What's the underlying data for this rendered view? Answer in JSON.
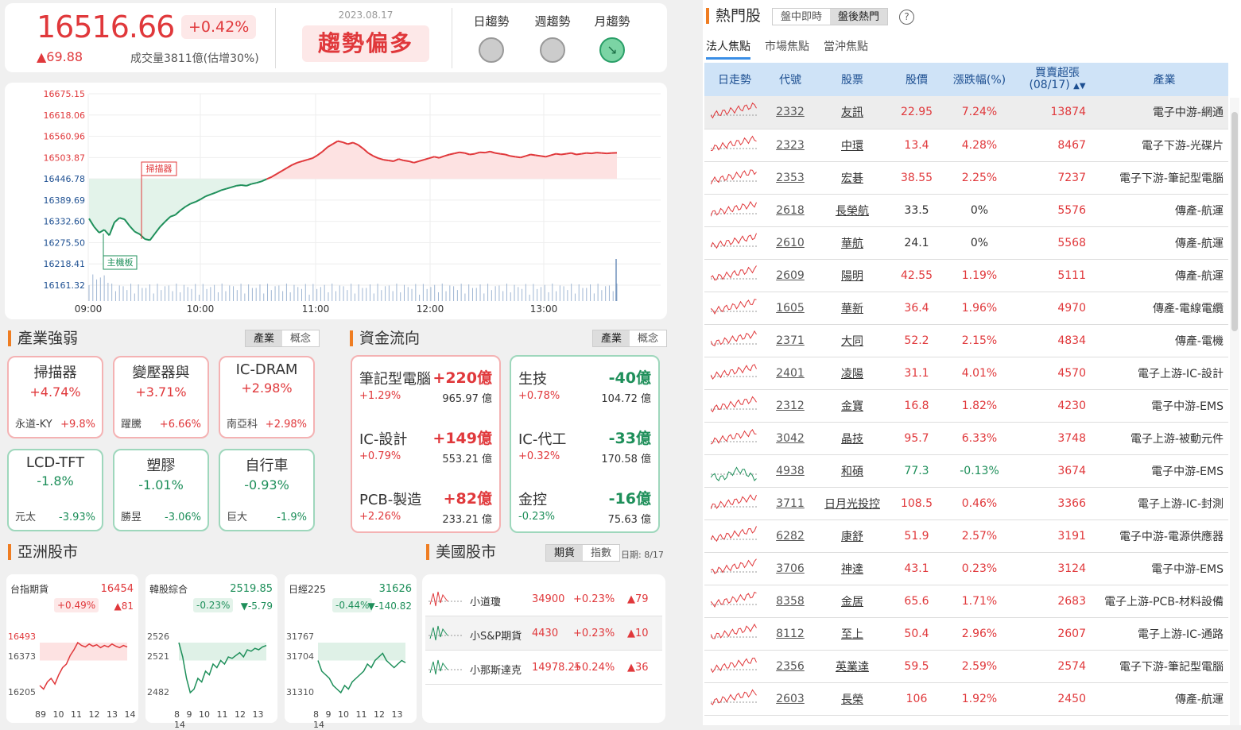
{
  "header": {
    "index_value": "16516.66",
    "index_pct": "+0.42%",
    "index_change": "▲69.88",
    "volume": "成交量3811億(估增30%)",
    "date": "2023.08.17",
    "trend": "趨勢偏多",
    "trends": [
      {
        "label": "日趨勢",
        "state": "neutral"
      },
      {
        "label": "週趨勢",
        "state": "neutral"
      },
      {
        "label": "月趨勢",
        "state": "down"
      }
    ]
  },
  "chart_data": {
    "type": "line",
    "title": "",
    "y_ticks": [
      "16675.15",
      "16618.06",
      "16560.96",
      "16503.87",
      "16446.78",
      "16389.69",
      "16332.60",
      "16275.50",
      "16218.41",
      "16161.32"
    ],
    "ylim": [
      16161.32,
      16675.15
    ],
    "reference": 16446.78,
    "x_ticks": [
      "09:00",
      "10:00",
      "11:00",
      "12:00",
      "13:00"
    ],
    "annotations": [
      {
        "label": "掃描器"
      },
      {
        "label": "主機板"
      }
    ],
    "series": [
      {
        "values": [
          16340,
          16318,
          16302,
          16310,
          16295,
          16330,
          16342,
          16338,
          16320,
          16305,
          16298,
          16285,
          16282,
          16300,
          16318,
          16332,
          16345,
          16350,
          16362,
          16372,
          16380,
          16385,
          16392,
          16400,
          16405,
          16410,
          16416,
          16420,
          16424,
          16428,
          16430,
          16428,
          16433,
          16436,
          16440,
          16446,
          16452,
          16460,
          16468,
          16476,
          16484,
          16490,
          16494,
          16498,
          16502,
          16510,
          16520,
          16532,
          16540,
          16548,
          16545,
          16540,
          16544,
          16538,
          16528,
          16516,
          16508,
          16502,
          16498,
          16496,
          16494,
          16500,
          16496,
          16494,
          16490,
          16494,
          16498,
          16502,
          16506,
          16503,
          16508,
          16512,
          16515,
          16518,
          16516,
          16512,
          16514,
          16518,
          16517,
          16520,
          16516,
          16514,
          16512,
          16508,
          16506,
          16504,
          16508,
          16512,
          16510,
          16508,
          16506,
          16510,
          16514,
          16512,
          16514,
          16516,
          16512,
          16514,
          16516,
          16515,
          16517,
          16516,
          16515,
          16516,
          16516.66
        ]
      }
    ]
  },
  "industry": {
    "title": "產業強弱",
    "toggle": [
      "產業",
      "概念"
    ],
    "cards": [
      {
        "name": "掃描器",
        "pct": "+4.74%",
        "stock": "永道-KY",
        "stock_pct": "+9.8%",
        "dir": "up"
      },
      {
        "name": "變壓器與",
        "pct": "+3.71%",
        "stock": "躍騰",
        "stock_pct": "+6.66%",
        "dir": "up"
      },
      {
        "name": "IC-DRAM",
        "pct": "+2.98%",
        "stock": "南亞科",
        "stock_pct": "+2.98%",
        "dir": "up"
      },
      {
        "name": "LCD-TFT",
        "pct": "-1.8%",
        "stock": "元太",
        "stock_pct": "-3.93%",
        "dir": "dn"
      },
      {
        "name": "塑膠",
        "pct": "-1.01%",
        "stock": "勝昱",
        "stock_pct": "-3.06%",
        "dir": "dn"
      },
      {
        "name": "自行車",
        "pct": "-0.93%",
        "stock": "巨大",
        "stock_pct": "-1.9%",
        "dir": "dn"
      }
    ]
  },
  "flow": {
    "title": "資金流向",
    "toggle": [
      "產業",
      "概念"
    ],
    "inflow": [
      {
        "name": "筆記型電腦",
        "amount": "+220億",
        "pct": "+1.29%",
        "value": "965.97 億"
      },
      {
        "name": "IC-設計",
        "amount": "+149億",
        "pct": "+0.79%",
        "value": "553.21 億"
      },
      {
        "name": "PCB-製造",
        "amount": "+82億",
        "pct": "+2.26%",
        "value": "233.21 億"
      }
    ],
    "outflow": [
      {
        "name": "生技",
        "amount": "-40億",
        "pct": "+0.78%",
        "value": "104.72 億"
      },
      {
        "name": "IC-代工",
        "amount": "-33億",
        "pct": "+0.32%",
        "value": "170.58 億"
      },
      {
        "name": "金控",
        "amount": "-16億",
        "pct": "-0.23%",
        "value": "75.63 億"
      }
    ]
  },
  "asia": {
    "title": "亞洲股市",
    "markets": [
      {
        "name": "台指期貨",
        "price": "16454",
        "pct": "+0.49%",
        "chg": "▲81",
        "hi": "16493",
        "mid": "16373",
        "lo": "16205",
        "ticks": "89 10 11 12 13 14",
        "pct_dir": "up"
      },
      {
        "name": "韓股綜合",
        "price": "2519.85",
        "pct": "-0.23%",
        "chg": "▼-5.79",
        "hi": "2526",
        "mid": "2521",
        "lo": "2482",
        "ticks": "8 9 10 11 12 13 14",
        "pct_dir": "dn"
      },
      {
        "name": "日經225",
        "price": "31626",
        "pct": "-0.44%",
        "chg": "▼-140.82",
        "hi": "31767",
        "mid": "31704",
        "lo": "31310",
        "ticks": "8 9 10 11 12 13 14",
        "pct_dir": "dn"
      }
    ]
  },
  "us": {
    "title": "美國股市",
    "toggle": [
      "期貨",
      "指數"
    ],
    "date": "日期: 8/17",
    "rows": [
      {
        "name": "小道瓊",
        "price": "34900",
        "pct": "+0.23%",
        "chg": "▲79"
      },
      {
        "name": "小S&P期貨",
        "price": "4430",
        "pct": "+0.23%",
        "chg": "▲10"
      },
      {
        "name": "小那斯達克",
        "price": "14978.25",
        "pct": "+0.24%",
        "chg": "▲36"
      }
    ]
  },
  "hot": {
    "title": "熱門股",
    "toggle": [
      "盤中即時",
      "盤後熱門"
    ],
    "tabs": [
      "法人焦點",
      "市場焦點",
      "當沖焦點"
    ],
    "columns": [
      "日走勢",
      "代號",
      "股票",
      "股價",
      "漲跌幅(%)",
      "買賣超張 (08/17)",
      "產業"
    ],
    "rows": [
      {
        "code": "2332",
        "name": "友訊",
        "price": "22.95",
        "pct": "7.24%",
        "vol": "13874",
        "ind": "電子中游-網通",
        "dir": "up"
      },
      {
        "code": "2323",
        "name": "中環",
        "price": "13.4",
        "pct": "4.28%",
        "vol": "8467",
        "ind": "電子下游-光碟片",
        "dir": "up"
      },
      {
        "code": "2353",
        "name": "宏碁",
        "price": "38.55",
        "pct": "2.25%",
        "vol": "7237",
        "ind": "電子下游-筆記型電腦",
        "dir": "up"
      },
      {
        "code": "2618",
        "name": "長榮航",
        "price": "33.5",
        "pct": "0%",
        "vol": "5576",
        "ind": "傳產-航運",
        "dir": "flat"
      },
      {
        "code": "2610",
        "name": "華航",
        "price": "24.1",
        "pct": "0%",
        "vol": "5568",
        "ind": "傳產-航運",
        "dir": "flat"
      },
      {
        "code": "2609",
        "name": "陽明",
        "price": "42.55",
        "pct": "1.19%",
        "vol": "5111",
        "ind": "傳產-航運",
        "dir": "up"
      },
      {
        "code": "1605",
        "name": "華新",
        "price": "36.4",
        "pct": "1.96%",
        "vol": "4970",
        "ind": "傳產-電線電纜",
        "dir": "up"
      },
      {
        "code": "2371",
        "name": "大同",
        "price": "52.2",
        "pct": "2.15%",
        "vol": "4834",
        "ind": "傳產-電機",
        "dir": "up"
      },
      {
        "code": "2401",
        "name": "凌陽",
        "price": "31.1",
        "pct": "4.01%",
        "vol": "4570",
        "ind": "電子上游-IC-設計",
        "dir": "up"
      },
      {
        "code": "2312",
        "name": "金寶",
        "price": "16.8",
        "pct": "1.82%",
        "vol": "4230",
        "ind": "電子中游-EMS",
        "dir": "up"
      },
      {
        "code": "3042",
        "name": "晶技",
        "price": "95.7",
        "pct": "6.33%",
        "vol": "3748",
        "ind": "電子上游-被動元件",
        "dir": "up"
      },
      {
        "code": "4938",
        "name": "和碩",
        "price": "77.3",
        "pct": "-0.13%",
        "vol": "3674",
        "ind": "電子中游-EMS",
        "dir": "dn"
      },
      {
        "code": "3711",
        "name": "日月光投控",
        "price": "108.5",
        "pct": "0.46%",
        "vol": "3366",
        "ind": "電子上游-IC-封測",
        "dir": "up"
      },
      {
        "code": "6282",
        "name": "康舒",
        "price": "51.9",
        "pct": "2.57%",
        "vol": "3191",
        "ind": "電子中游-電源供應器",
        "dir": "up"
      },
      {
        "code": "3706",
        "name": "神達",
        "price": "43.1",
        "pct": "0.23%",
        "vol": "3124",
        "ind": "電子中游-EMS",
        "dir": "up"
      },
      {
        "code": "8358",
        "name": "金居",
        "price": "65.6",
        "pct": "1.71%",
        "vol": "2683",
        "ind": "電子上游-PCB-材料設備",
        "dir": "up"
      },
      {
        "code": "8112",
        "name": "至上",
        "price": "50.4",
        "pct": "2.96%",
        "vol": "2607",
        "ind": "電子上游-IC-通路",
        "dir": "up"
      },
      {
        "code": "2356",
        "name": "英業達",
        "price": "59.5",
        "pct": "2.59%",
        "vol": "2574",
        "ind": "電子下游-筆記型電腦",
        "dir": "up"
      },
      {
        "code": "2603",
        "name": "長榮",
        "price": "106",
        "pct": "1.92%",
        "vol": "2450",
        "ind": "傳產-航運",
        "dir": "up"
      }
    ]
  },
  "colors": {
    "up": "#e0383b",
    "down": "#1e8f5a",
    "accent": "#ef7d22",
    "header_bg": "#cfe3f7"
  }
}
